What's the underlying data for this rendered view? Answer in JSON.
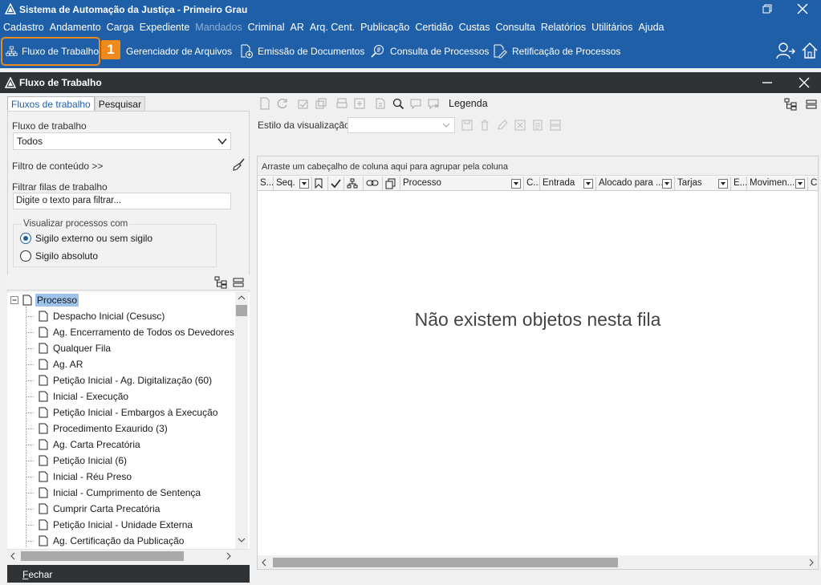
{
  "window": {
    "title": "Sistema de Automação da Justiça - Primeiro Grau"
  },
  "menu": [
    {
      "label": "Cadastro",
      "enabled": true
    },
    {
      "label": "Andamento",
      "enabled": true
    },
    {
      "label": "Carga",
      "enabled": true
    },
    {
      "label": "Expediente",
      "enabled": true
    },
    {
      "label": "Mandados",
      "enabled": false
    },
    {
      "label": "Criminal",
      "enabled": true
    },
    {
      "label": "AR",
      "enabled": true
    },
    {
      "label": "Arq. Cent.",
      "enabled": true
    },
    {
      "label": "Publicação",
      "enabled": true
    },
    {
      "label": "Certidão",
      "enabled": true
    },
    {
      "label": "Custas",
      "enabled": true
    },
    {
      "label": "Consulta",
      "enabled": true
    },
    {
      "label": "Relatórios",
      "enabled": true
    },
    {
      "label": "Utilitários",
      "enabled": true
    },
    {
      "label": "Ajuda",
      "enabled": true
    }
  ],
  "quickbar": {
    "fluxo": "Fluxo de Trabalho",
    "step_badge": "1",
    "gerenciador": "Gerenciador de Arquivos",
    "emissao": "Emissão de Documentos",
    "consulta": "Consulta de Processos",
    "retificacao": "Retificação de Processos"
  },
  "doc": {
    "title": "Fluxo de Trabalho"
  },
  "left": {
    "tabs": [
      "Fluxos de trabalho",
      "Pesquisar"
    ],
    "fluxo_label": "Fluxo de trabalho",
    "fluxo_value": "Todos",
    "filtro_conteudo": "Filtro de conteúdo >>",
    "filtrar_label": "Filtrar filas de trabalho",
    "filtrar_placeholder": "Digite o texto para filtrar...",
    "visualizar_legend": "Visualizar processos com",
    "radio_externo": "Sigilo externo ou sem sigilo",
    "radio_absoluto": "Sigilo absoluto",
    "radio_selected": "externo",
    "tree_root": "Processo",
    "tree_items": [
      "Despacho Inicial (Cesusc)",
      "Ag. Encerramento de Todos os Devedores (",
      "Qualquer Fila",
      "Ag. AR",
      "Petição Inicial - Ag. Digitalização (60)",
      "Inicial - Execução",
      "Petição Inicial - Embargos à Execução",
      "Procedimento Exaurido (3)",
      "Ag. Carta Precatória",
      "Petição Inicial (6)",
      "Inicial - Réu Preso",
      "Inicial - Cumprimento de Sentença",
      "Cumprir Carta Precatória",
      "Petição Inicial - Unidade Externa",
      "Ag. Certificação da Publicação"
    ],
    "close_prefix": "F",
    "close_rest": "echar"
  },
  "right": {
    "legenda": "Legenda",
    "estilo_label": "Estilo da visualização",
    "group_hint": "Arraste um cabeçalho de coluna aqui para agrupar pela coluna",
    "columns": [
      "S...",
      "Seq.",
      "",
      "",
      "",
      "",
      "",
      "Processo",
      "C...",
      "Entrada",
      "Alocado para ...",
      "Tarjas",
      "E...",
      "Movimen...",
      "C"
    ],
    "empty_message": "Não existem objetos nesta fila"
  },
  "colors": {
    "brand_blue": "#1f5fa8",
    "highlight_orange": "#f08a1c",
    "dark_bar": "#2f3336",
    "selection": "#9dc3ea"
  }
}
